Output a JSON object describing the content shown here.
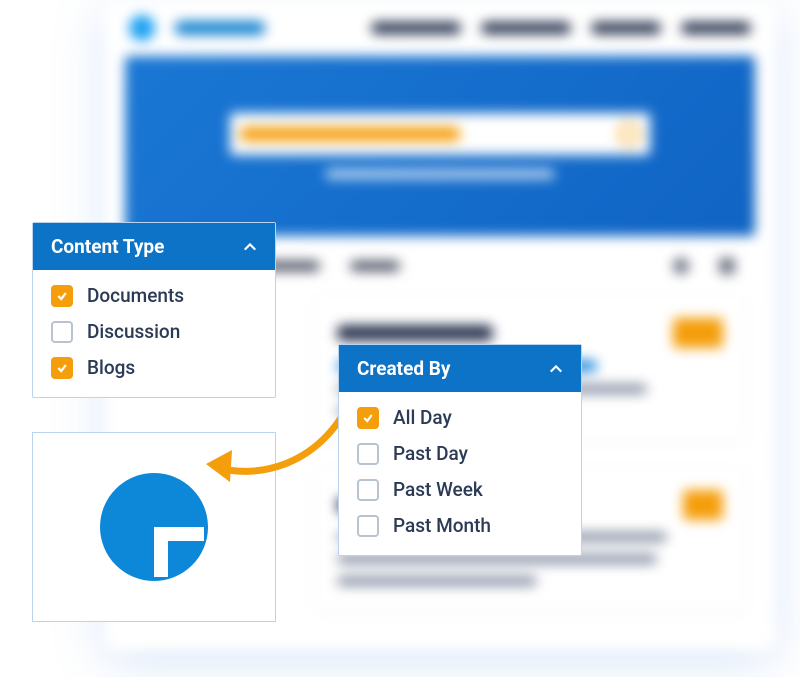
{
  "content_type_panel": {
    "title": "Content Type",
    "items": [
      {
        "label": "Documents",
        "checked": true
      },
      {
        "label": "Discussion",
        "checked": false
      },
      {
        "label": "Blogs",
        "checked": true
      }
    ]
  },
  "created_by_panel": {
    "title": "Created By",
    "items": [
      {
        "label": "All Day",
        "checked": true
      },
      {
        "label": "Past Day",
        "checked": false
      },
      {
        "label": "Past Week",
        "checked": false
      },
      {
        "label": "Past Month",
        "checked": false
      }
    ]
  }
}
